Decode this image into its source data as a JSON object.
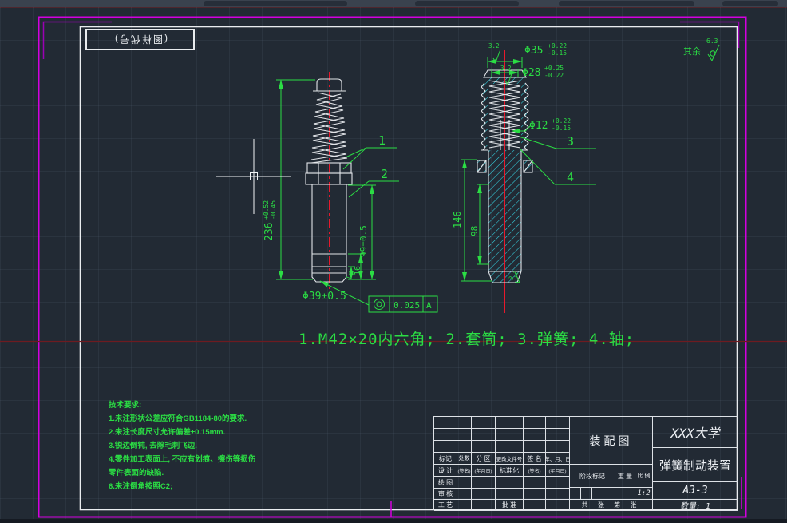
{
  "colors": {
    "dimension_green": "#2bdd44",
    "hatch_cyan": "#35d0e0",
    "centerline_red": "#e8192c",
    "border_magenta": "#d400e0",
    "sheet_line_white": "#e9ecef",
    "construction_red": "#6e1b20",
    "canvas_background": "#222a34"
  },
  "sheet": {
    "code_label": "(图样代号)",
    "surplus_label": "其余",
    "surplus_roughness": "6.3"
  },
  "left_view": {
    "callout_1": "1",
    "callout_2": "2",
    "dim_height": {
      "main": "236",
      "upper": "+0.52",
      "lower": "-0.45"
    },
    "dim_99": "99±0.5",
    "dim_16": "16",
    "dim_7": "7",
    "dim_dia39": "Φ39±0.5",
    "tolerance": {
      "value": "0.025",
      "datum": "A"
    }
  },
  "right_view": {
    "callout_3": "3",
    "callout_4": "4",
    "dim_dia35": {
      "main": "Φ35",
      "upper": "+0.22",
      "lower": "-0.15"
    },
    "dim_dia28": {
      "main": "Φ28",
      "upper": "+0.25",
      "lower": "-0.22"
    },
    "dim_dia12": {
      "main": "Φ12",
      "upper": "+0.22",
      "lower": "-0.15"
    },
    "dim_146": "146",
    "dim_98": "98",
    "roughness_top_1": "3.2",
    "roughness_top_2": "3.2",
    "roughness_bottom": "3.2"
  },
  "notes": {
    "parts_list": "1.M42×20内六角; 2.套筒; 3.弹簧; 4.轴;"
  },
  "tech_requirements": {
    "title": "技术要求:",
    "lines": [
      "1.未注形状公差应符合GB1184-80的要求.",
      "2.未注长度尺寸允许偏差±0.15mm.",
      "3.锐边倒钝, 去除毛刺飞边.",
      "4.零件加工表面上, 不应有划痕、擦伤等损伤",
      "零件表面的缺陷.",
      "6.未注倒角按照C2;"
    ]
  },
  "title_block": {
    "drawing_title": "装配图",
    "org": "XXX大学",
    "product": "弹簧制动装置",
    "code": "A3-3",
    "quantity": "数量: 1",
    "scale_value": "1:2",
    "rev_headers": [
      "标记",
      "处数",
      "分 区",
      "更改文件号",
      "签 名",
      "年、月、日"
    ],
    "design_row": [
      "设 计",
      "(签名)",
      "(年月日)",
      "标准化",
      "(签名)",
      "(年月日)"
    ],
    "label_draw": "绘 图",
    "label_check": "审 核",
    "label_process": "工 艺",
    "label_approve": "批 准",
    "stage_label": "阶段标记",
    "weight_label": "重 量",
    "scale_label": "比 例",
    "pages_label": "共 张 第 张"
  }
}
